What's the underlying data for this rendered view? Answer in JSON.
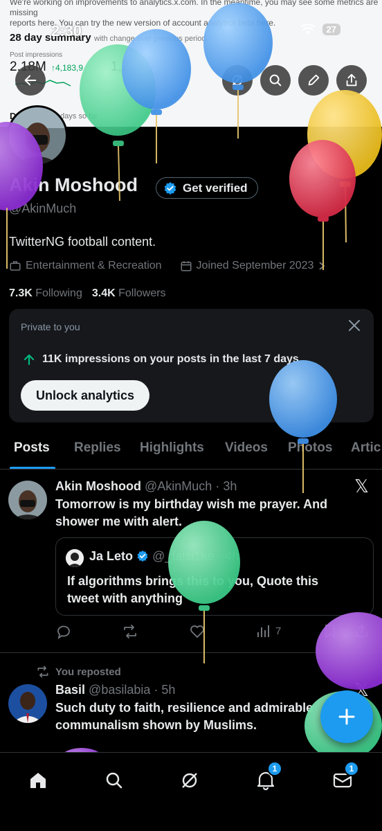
{
  "banner": {
    "notice": "We're working on improvements to analytics.x.com. In the meantime, you may see some metrics are missing",
    "notice_line2": "reports here. You can try the new version of account analytics beta here.",
    "summary_title": "28 day summary",
    "summary_sub": "with change over previous period",
    "impressions_label": "Post impressions",
    "impressions_value": "2.18M",
    "impressions_change": "↑4,183,9",
    "second_value": "1,228",
    "d_row": "D",
    "d_row_sub": "9 days so far"
  },
  "status_bar": {
    "time": "2:30",
    "battery": "27"
  },
  "profile": {
    "name": "Akin Moshood",
    "verify_label": "Get verified",
    "handle": "@AkinMuch",
    "bio": "TwitterNG football content.",
    "category": "Entertainment & Recreation",
    "joined": "Joined September 2023",
    "following_count": "7.3K",
    "following_label": "Following",
    "followers_count": "3.4K",
    "followers_label": "Followers"
  },
  "private_card": {
    "title": "Private to you",
    "impressions_text": "11K impressions on your posts in the last 7 days",
    "button": "Unlock analytics"
  },
  "tabs": [
    "Posts",
    "Replies",
    "Highlights",
    "Videos",
    "Photos",
    "Artic"
  ],
  "posts": [
    {
      "name": "Akin Moshood",
      "handle": "@AkinMuch · 3h",
      "text_line1": "Tomorrow is my birthday wish me prayer. And",
      "text_line2": "shower me with alert.",
      "quote": {
        "name": "Ja Leto",
        "handle": "@_falsi1ke · 4h",
        "text_line1": "If algorithms brings this to you, Quote this",
        "text_line2": "tweet with anything"
      },
      "views": "7"
    },
    {
      "reposted_label": "You reposted",
      "name": "Basil",
      "handle": "@basilabia · 5h",
      "text_line1": "Such duty to faith, resilience and admirable",
      "text_line2": "communalism shown by Muslims."
    }
  ],
  "nav": {
    "notifications_badge": "1",
    "messages_badge": "1"
  },
  "colors": {
    "accent": "#1d9bf0",
    "muted": "#71767b",
    "text": "#e7e9ea",
    "card_bg": "#16181c",
    "border": "#2f3336"
  }
}
